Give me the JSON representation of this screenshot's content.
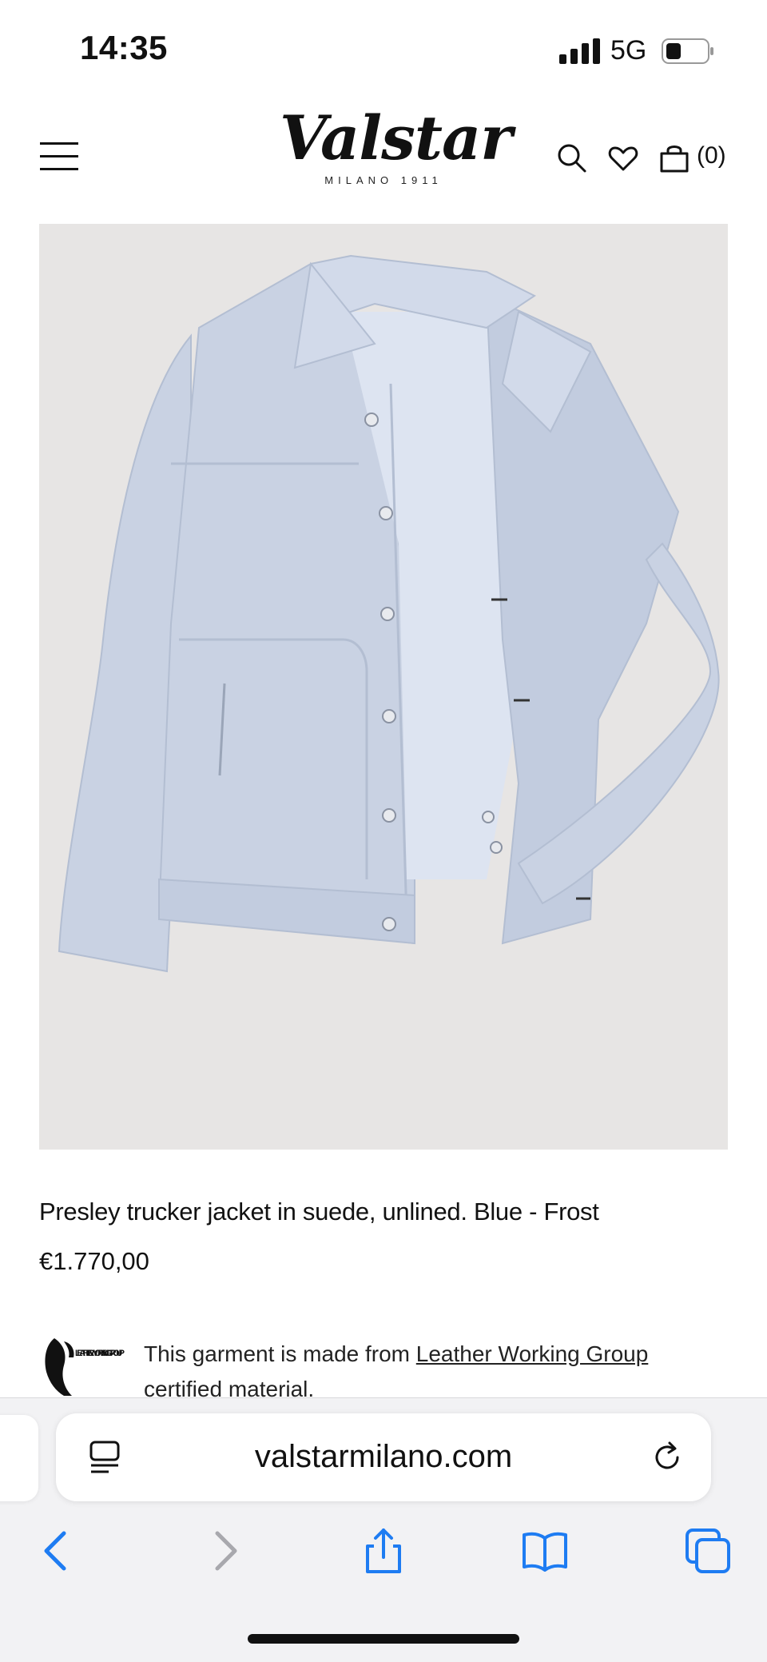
{
  "status_bar": {
    "time": "14:35",
    "network": "5G"
  },
  "header": {
    "logo_text": "Valstar",
    "logo_subtext": "MILANO 1911",
    "cart_count": "(0)",
    "icons": [
      "menu-icon",
      "search-icon",
      "heart-icon",
      "bag-icon"
    ]
  },
  "product": {
    "title": "Presley trucker jacket in suede, unlined. Blue - Frost",
    "price": "€1.770,00",
    "image_icon": "jacket-illustration",
    "image_bg": "#e7e5e4",
    "jacket_color": "#c9d2e3"
  },
  "certification": {
    "logo_text": "LEATHER WORKING GROUP",
    "text_before": "This garment is made from ",
    "link_text": "Leather Working Group",
    "text_after": "certified material."
  },
  "browser": {
    "url": "valstarmilano.com",
    "accent": "#1e7cf2",
    "toolbar": [
      "back-icon",
      "forward-icon",
      "share-icon",
      "bookmarks-icon",
      "tabs-icon"
    ]
  }
}
